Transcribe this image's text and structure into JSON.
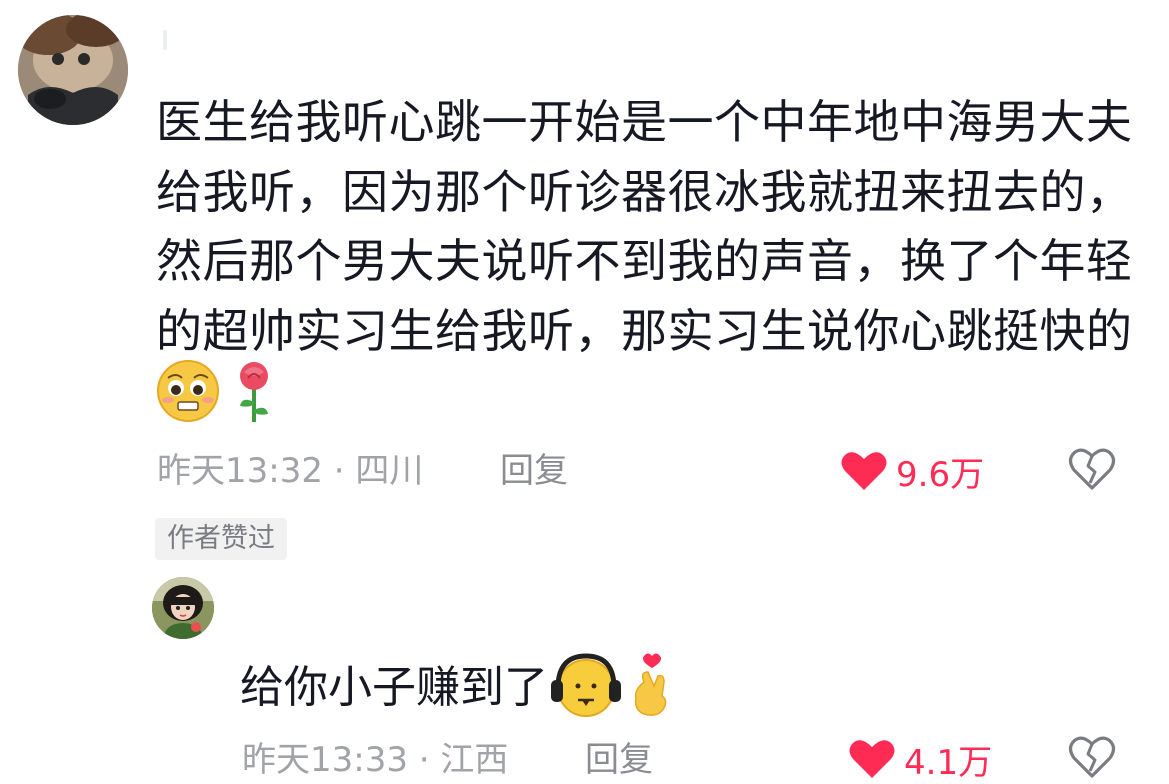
{
  "comment": {
    "text": "医生给我听心跳一开始是一个中年地中海男大夫给我听，因为那个听诊器很冰我就扭来扭去的，然后那个男大夫说听不到我的声音，换了个年轻的超帅实习生给我听，那实习生说你心跳挺快的",
    "emojis": [
      "pleading-face-icon",
      "rose-icon"
    ],
    "time_location": "昨天13:32 · 四川",
    "reply_label": "回复",
    "like_count": "9.6万",
    "author_liked": "作者赞过"
  },
  "reply": {
    "text": "给你小子赚到了",
    "emojis": [
      "headphones-face-icon",
      "finger-heart-icon"
    ],
    "time_location": "昨天13:33 · 江西",
    "reply_label": "回复",
    "like_count": "4.1万"
  },
  "colors": {
    "like": "#fe2c55",
    "meta": "#a1a3a8",
    "text": "#161823",
    "badge_bg": "#f1f1f2"
  }
}
